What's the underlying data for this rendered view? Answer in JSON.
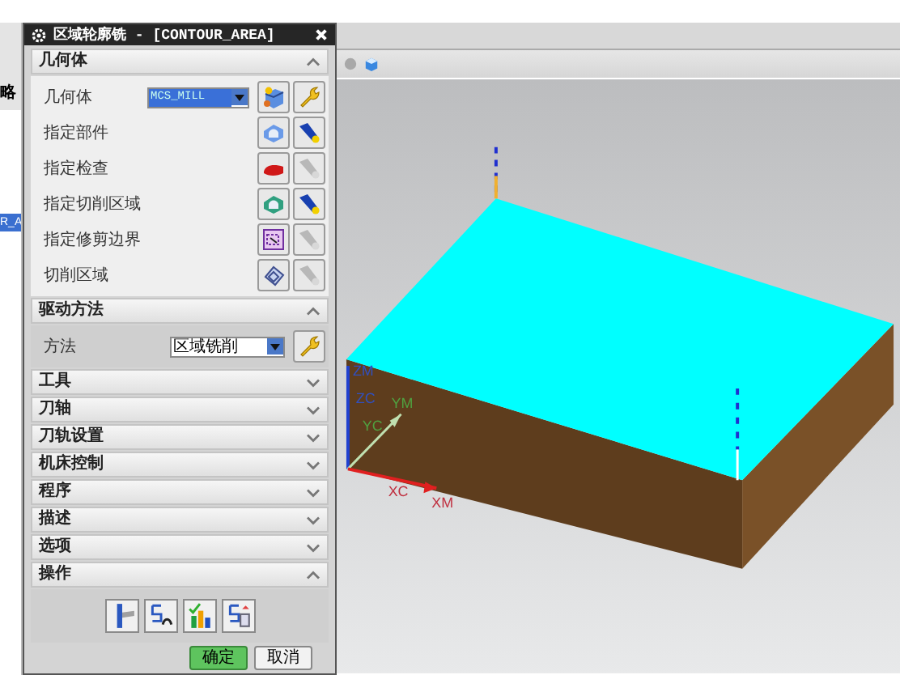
{
  "left_list": {
    "header": "略",
    "rows": [
      {
        "text": "R_A",
        "selected": true
      }
    ]
  },
  "dialog": {
    "title": "区域轮廓铣 - [CONTOUR_AREA]",
    "sections": [
      {
        "title": "几何体",
        "expanded": true,
        "kind": "rows",
        "rows": [
          {
            "label": "几何体",
            "kind": "dropdown",
            "value": "MCS_MILL",
            "highlighted": true
          },
          {
            "label": "指定部件",
            "kind": "select",
            "display_enabled": true
          },
          {
            "label": "指定检查",
            "kind": "select",
            "display_enabled": false
          },
          {
            "label": "指定切削区域",
            "kind": "select",
            "display_enabled": true
          },
          {
            "label": "指定修剪边界",
            "kind": "select",
            "display_enabled": false
          },
          {
            "label": "切削区域",
            "kind": "select",
            "display_enabled": false
          }
        ]
      },
      {
        "title": "驱动方法",
        "expanded": true,
        "kind": "rows",
        "rows": [
          {
            "label": "方法",
            "kind": "dropdown",
            "value": "区域铣削",
            "highlighted": false
          }
        ]
      },
      {
        "title": "工具",
        "expanded": false
      },
      {
        "title": "刀轴",
        "expanded": false
      },
      {
        "title": "刀轨设置",
        "expanded": false
      },
      {
        "title": "机床控制",
        "expanded": false
      },
      {
        "title": "程序",
        "expanded": false
      },
      {
        "title": "描述",
        "expanded": false
      },
      {
        "title": "选项",
        "expanded": false
      },
      {
        "title": "操作",
        "expanded": true,
        "kind": "actions"
      }
    ],
    "buttons": [
      {
        "label": "确定",
        "kind": "primary"
      },
      {
        "label": "取消",
        "kind": "secondary"
      }
    ]
  },
  "viewport": {
    "axis_labels": [
      {
        "text": "ZM"
      },
      {
        "text": "ZC"
      },
      {
        "text": "YM"
      },
      {
        "text": "YC"
      },
      {
        "text": "XC"
      },
      {
        "text": "XM"
      }
    ]
  }
}
